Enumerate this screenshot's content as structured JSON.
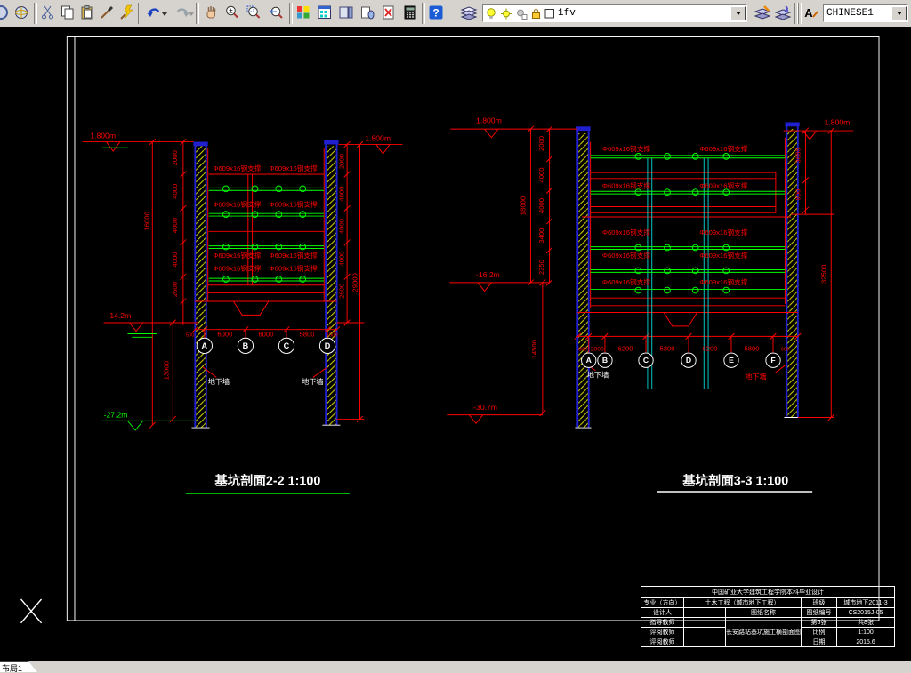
{
  "toolbar": {
    "layer_value": "1fv",
    "style_value": "CHINESE1",
    "icon_glyphs": {
      "help": "?",
      "zoom_pm": "±",
      "style": "A"
    }
  },
  "statusbar": {
    "layout_tab": "布局1"
  },
  "labels": {
    "steel_support": "Φ609x16钢支撑",
    "wall": "地下墙"
  },
  "drawing1": {
    "title": "基坑剖面2-2 1:100",
    "elev_ground": "1.800m",
    "elev_pit": "-14.2m",
    "elev_wall_bottom": "-27.2m",
    "grid": [
      "A",
      "B",
      "C",
      "D"
    ],
    "bottom_dims": [
      "500",
      "6000",
      "6000",
      "5800",
      "500"
    ],
    "left_chain": [
      "2000",
      "4000",
      "4000",
      "4000",
      "2600"
    ],
    "left_total": "16000",
    "below_dim": "13000",
    "right_total": "29000"
  },
  "drawing2": {
    "title": "基坑剖面3-3 1:100",
    "elev_ground": "1.800m",
    "elev_pit": "-16.2m",
    "elev_wall_bottom": "-30.7m",
    "grid": [
      "A",
      "B",
      "C",
      "D",
      "E",
      "F"
    ],
    "bottom_dims": [
      "2000",
      "6200",
      "5300",
      "6200",
      "5800"
    ],
    "end_dims": [
      "800",
      "600"
    ],
    "left_chain": [
      "2000",
      "4000",
      "4000",
      "3400",
      "2350"
    ],
    "left_total": "18000",
    "below_dim": "14500",
    "right_dims": [
      "3685",
      "900"
    ],
    "right_total": "32500"
  },
  "titleblock": {
    "header": "中国矿业大学建筑工程学院本科毕业设计",
    "major_label": "专业（方向）",
    "major_value": "土木工程（城市地下工程）",
    "class_label": "班级",
    "class_value": "城市地下2011-3",
    "designer_label": "设计人",
    "name_label": "图纸名称",
    "number_label": "图纸编号",
    "number_value": "CS2015J-05",
    "advisor_label": "指导教师",
    "sheet_label": "第5张",
    "sheet_total": "共8张",
    "reviewer1_label": "评阅教师",
    "scale_label": "比例",
    "scale_value": "1:100",
    "reviewer2_label": "评阅教师",
    "date_label": "日期",
    "date_value": "2015.6",
    "drawing_name": "长安路站基坑施工横剖面图"
  }
}
